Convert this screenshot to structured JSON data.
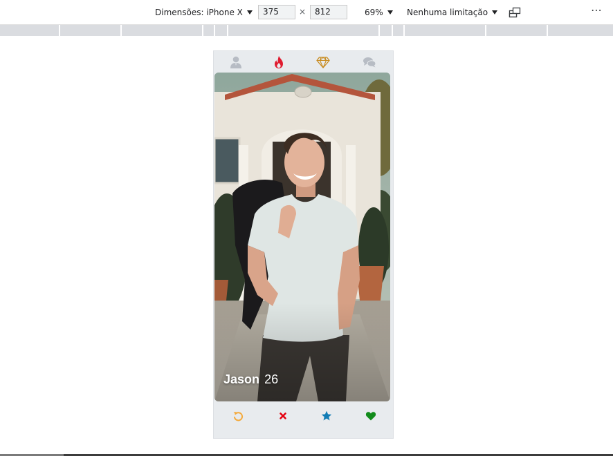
{
  "devtools": {
    "dimensions_label": "Dimensões: iPhone X",
    "width_value": "375",
    "times": "×",
    "height_value": "812",
    "zoom": "69%",
    "throttling": "Nenhuma limitação",
    "more_label": "⋯",
    "icons": [
      "chevron-down-icon",
      "rotate-icon",
      "more-icon"
    ]
  },
  "app": {
    "nav_icons": [
      "profile-icon",
      "flame-icon",
      "diamond-icon",
      "chat-icon"
    ],
    "colors": {
      "nav_inactive": "#b7bcc4",
      "flame": "#e01b2f",
      "diamond": "#c88b1e",
      "undo": "#f4a93a",
      "nope": "#e5000f",
      "star": "#117cb5",
      "like": "#118b1b"
    },
    "card": {
      "name": "Jason",
      "age": "26"
    },
    "actions": [
      "undo-icon",
      "close-icon",
      "star-icon",
      "heart-icon"
    ]
  }
}
